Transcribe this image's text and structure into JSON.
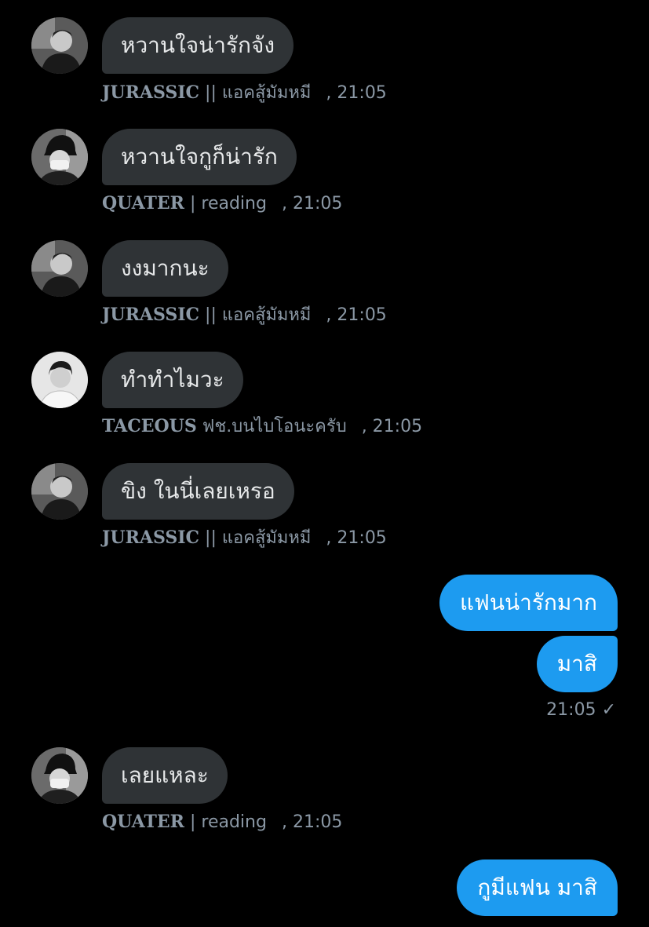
{
  "messages": [
    {
      "text": "หวานใจน่ารักจัง",
      "name": "JURASSIC",
      "separator": "||",
      "status": "แอคสู้มัมหมี",
      "time": ", 21:05",
      "avatar": "avatar-jurassic-icon"
    },
    {
      "text": "หวานใจกูก็น่ารัก",
      "name": "QUATER",
      "separator": "|",
      "status": "reading",
      "time": ", 21:05",
      "avatar": "avatar-quater-icon"
    },
    {
      "text": "งงมากนะ",
      "name": "JURASSIC",
      "separator": "||",
      "status": "แอคสู้มัมหมี",
      "time": ", 21:05",
      "avatar": "avatar-jurassic-icon"
    },
    {
      "text": "ทำทำไมวะ",
      "name": "TACEOUS",
      "separator": "",
      "status": "ฟช.บนไบโอนะครับ",
      "time": ", 21:05",
      "avatar": "avatar-taceous-icon"
    },
    {
      "text": "ขิง ในนี่เลยเหรอ",
      "name": "JURASSIC",
      "separator": "||",
      "status": "แอคสู้มัมหมี",
      "time": ", 21:05",
      "avatar": "avatar-jurassic-icon"
    },
    {
      "text": "เลยแหละ",
      "name": "QUATER",
      "separator": "|",
      "status": "reading",
      "time": ", 21:05",
      "avatar": "avatar-quater-icon"
    }
  ],
  "outgoing": [
    {
      "text": "แฟนน่ารักมาก"
    },
    {
      "text": "มาสิ"
    },
    {
      "text": "กูมีแฟน มาสิ"
    }
  ],
  "outgoing_time": "21:05",
  "read_mark": "✓",
  "colors": {
    "background": "#000000",
    "incoming_bubble": "#2f3336",
    "outgoing_bubble": "#1d9bf0",
    "meta_text": "#8b98a5"
  }
}
